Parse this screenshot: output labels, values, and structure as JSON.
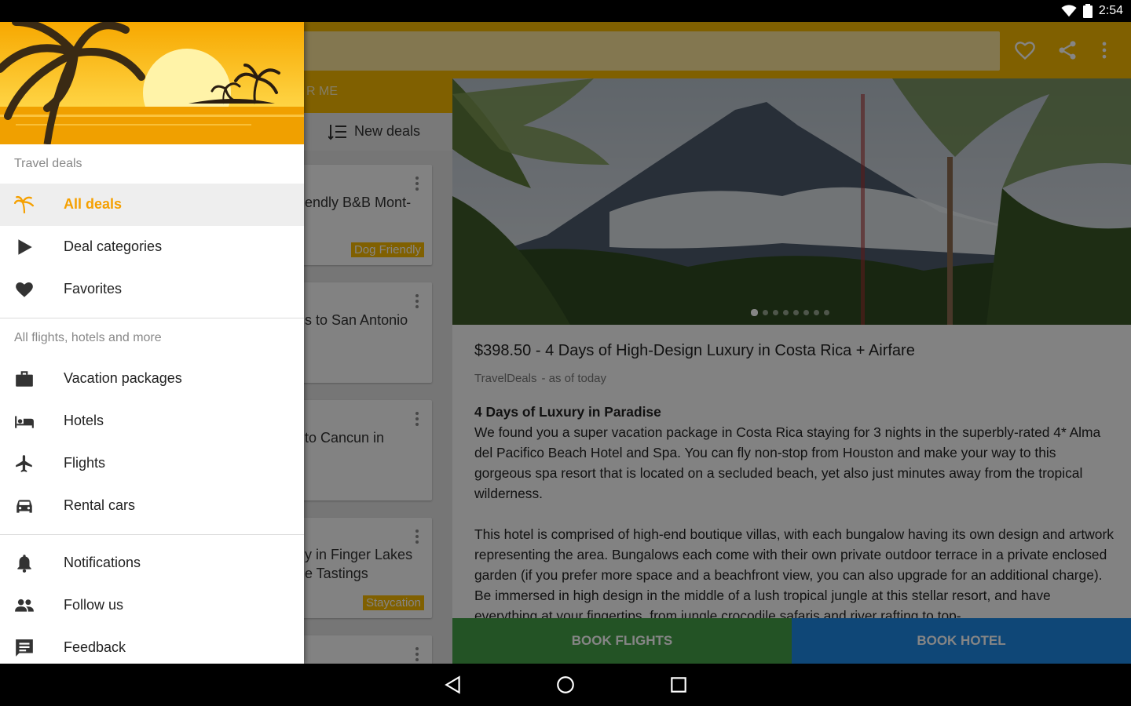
{
  "status_bar": {
    "time": "2:54",
    "icons": [
      "wifi-icon",
      "battery-icon"
    ]
  },
  "toolbar": {
    "icons": [
      "heart-outline-icon",
      "share-icon",
      "more-vert-icon"
    ]
  },
  "tabs": {
    "partial_label": "R ME"
  },
  "sort": {
    "label": "New deals"
  },
  "list": {
    "cards": [
      {
        "line1": "endly B&B Mont-",
        "line2": "",
        "tag": "Dog Friendly"
      },
      {
        "line1": "s to San Antonio",
        "line2": "",
        "tag": ""
      },
      {
        "line1": "to Cancun in",
        "line2": "",
        "tag": ""
      },
      {
        "line1": "y in Finger Lakes",
        "line2": "e Tastings",
        "tag": "Staycation"
      }
    ]
  },
  "deal": {
    "title": "$398.50 - 4 Days of High-Design Luxury in Costa Rica + Airfare",
    "source": "TravelDeals",
    "date": "- as of today",
    "heading": "4 Days of Luxury in Paradise",
    "paragraph1": "We found you a super vacation package in Costa Rica staying for 3 nights in the superbly-rated 4* Alma del Pacifico Beach Hotel and Spa. You can fly non-stop from Houston and make your way to this gorgeous spa resort that is located on a secluded beach, yet also just minutes away from the tropical wilderness.",
    "paragraph2": "This hotel is comprised of high-end boutique villas, with each bungalow having its own design and artwork representing the area. Bungalows each come with their own private outdoor terrace in a private enclosed garden (if you prefer more space and a beachfront view, you can also upgrade for an additional charge). Be immersed in high design in the middle of a lush tropical jungle at this stellar resort, and have everything at your fingertips, from jungle crocodile safaris and river rafting to top-",
    "book_flights": "BOOK FLIGHTS",
    "book_hotel": "BOOK HOTEL",
    "image_pages": 8,
    "image_current": 1
  },
  "drawer": {
    "section1": "Travel deals",
    "items1": [
      {
        "label": "All deals",
        "icon": "palm-tree-icon",
        "active": true
      },
      {
        "label": "Deal categories",
        "icon": "play-arrow-icon"
      },
      {
        "label": "Favorites",
        "icon": "heart-icon"
      }
    ],
    "section2": "All flights, hotels and more",
    "items2": [
      {
        "label": "Vacation packages",
        "icon": "briefcase-icon"
      },
      {
        "label": "Hotels",
        "icon": "bed-icon"
      },
      {
        "label": "Flights",
        "icon": "airplane-icon"
      },
      {
        "label": "Rental cars",
        "icon": "car-icon"
      }
    ],
    "items3": [
      {
        "label": "Notifications",
        "icon": "bell-icon"
      },
      {
        "label": "Follow us",
        "icon": "people-icon"
      },
      {
        "label": "Feedback",
        "icon": "feedback-icon"
      }
    ]
  },
  "colors": {
    "accent": "#f5b800",
    "active_text": "#f5a000",
    "book_flights": "#43a047",
    "book_hotel": "#1e88e5"
  }
}
